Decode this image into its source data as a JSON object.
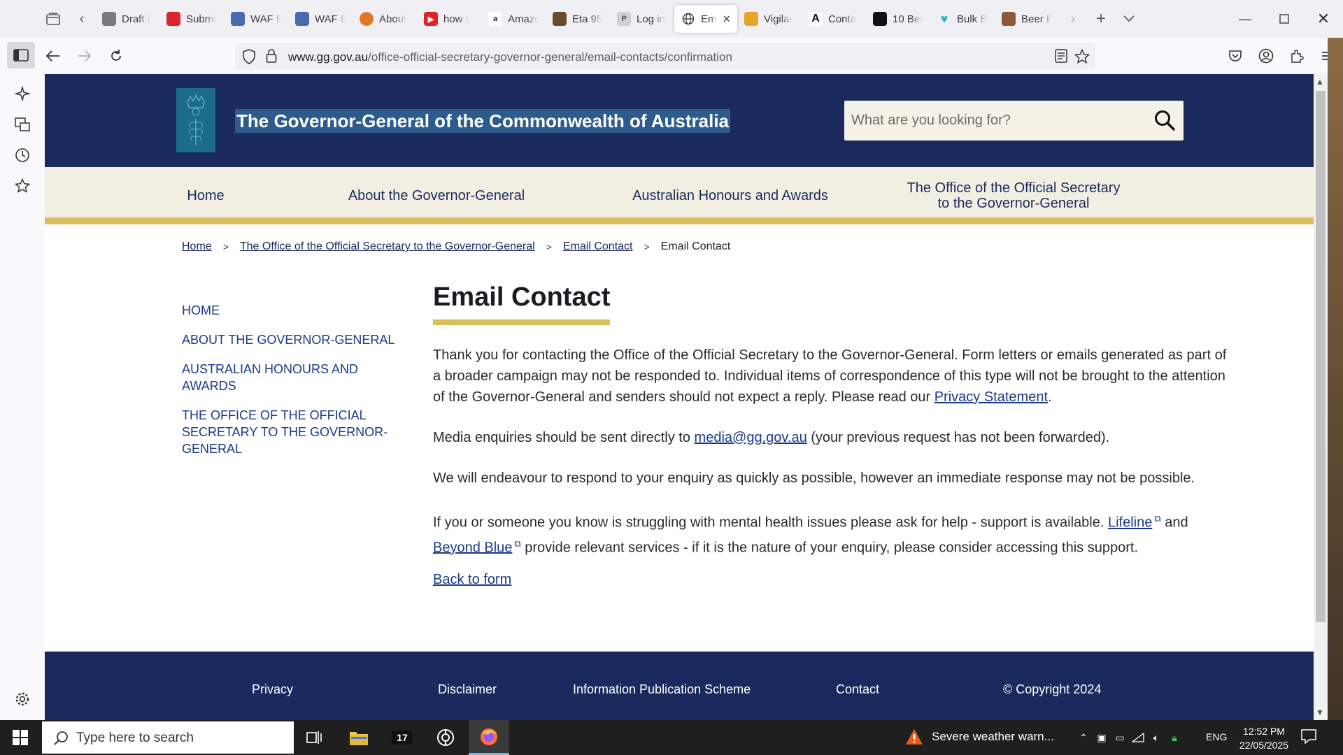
{
  "browser": {
    "tabs": [
      {
        "title": "Draft f",
        "icon_color": "#7a7a7a"
      },
      {
        "title": "Submi",
        "icon_color": "#d6262b"
      },
      {
        "title": "WAF E",
        "icon_color": "#4a6ab0"
      },
      {
        "title": "WAF E",
        "icon_color": "#4a6ab0"
      },
      {
        "title": "About",
        "icon_color": "#e07a2a"
      },
      {
        "title": "how t",
        "icon_color": "#e0232a"
      },
      {
        "title": "Amazo",
        "icon_color": "#222222"
      },
      {
        "title": "Eta 95",
        "icon_color": "#6a4a2a"
      },
      {
        "title": "Log in",
        "icon_color": "#8a8a8a"
      },
      {
        "title": "Em",
        "icon_color": "#444444",
        "active": true
      },
      {
        "title": "Vigilar",
        "icon_color": "#e6a62a"
      },
      {
        "title": "Conta",
        "icon_color": "#111111"
      },
      {
        "title": "10 Bes",
        "icon_color": "#111111"
      },
      {
        "title": "Bulk B",
        "icon_color": "#2bb7c4"
      },
      {
        "title": "Beer E",
        "icon_color": "#8a5a3a"
      }
    ],
    "url_domain": "www.gg.gov.au",
    "url_path": "/office-official-secretary-governor-general/email-contacts/confirmation"
  },
  "site": {
    "title": "The Governor-General of the Commonwealth of Australia",
    "search_placeholder": "What are you looking for?",
    "main_nav": [
      "Home",
      "About the Governor-General",
      "Australian Honours and Awards",
      "The Office of the Official Secretary to the Governor-General"
    ],
    "breadcrumb": [
      "Home",
      "The Office of the Official Secretary to the Governor-General",
      "Email Contact",
      "Email Contact"
    ],
    "left_nav": [
      "HOME",
      "ABOUT THE GOVERNOR-GENERAL",
      "AUSTRALIAN HONOURS AND AWARDS",
      "THE OFFICE OF THE OFFICIAL SECRETARY TO THE GOVERNOR-GENERAL"
    ],
    "page_title": "Email Contact",
    "p1_text": "Thank you for contacting the Office of the Official Secretary to the Governor-General. Form letters or emails generated as part of a broader campaign may not be responded to. Individual items of correspondence of this type will not be brought to the attention of the Governor-General and senders should not expect a reply. Please read our ",
    "p1_link": "Privacy Statement",
    "p1_end": ".",
    "p2_start": "Media enquiries should be sent directly to ",
    "p2_link": "media@gg.gov.au",
    "p2_end": " (your previous request has not been forwarded).",
    "p3_text": "We will endeavour to respond to your enquiry as quickly as possible, however an immediate response may not be possible.",
    "p4_start": "If you or someone you know is struggling with mental health issues please ask for help - support is available. ",
    "p4_link1": "Lifeline",
    "p4_mid": " and ",
    "p4_link2": "Beyond Blue",
    "p4_end": " provide relevant services - if it is the nature of your enquiry, please consider accessing this support.",
    "back_link": "Back to form",
    "footer": [
      "Privacy",
      "Disclaimer",
      "Information Publication Scheme",
      "Contact",
      "© Copyright 2024"
    ]
  },
  "taskbar": {
    "search_text": "Type here to search",
    "weather_text": "Severe weather warn...",
    "lang": "ENG",
    "time": "12:52 PM",
    "date": "22/05/2025"
  },
  "colors": {
    "header_navy": "#1b2a5e",
    "gold_accent": "#d8be5c",
    "nav_cream": "#f2efe2"
  }
}
